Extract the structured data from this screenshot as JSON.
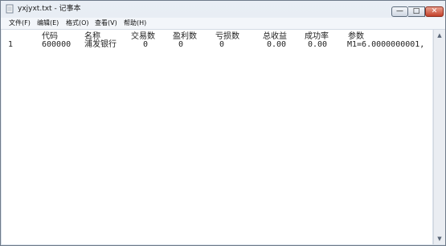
{
  "window": {
    "title": "yxjyxt.txt - 记事本"
  },
  "controls": {
    "minimize": "—",
    "maximize": "□",
    "close": "✕"
  },
  "menu": [
    "文件(F)",
    "编辑(E)",
    "格式(O)",
    "查看(V)",
    "帮助(H)"
  ],
  "editor": {
    "headers": [
      "代码",
      "名称",
      "交易数",
      "盈利数",
      "亏损数",
      "总收益",
      "成功率",
      "参数"
    ],
    "row": [
      "1",
      "600000",
      "浦发银行",
      "0",
      "0",
      "0",
      "0.00",
      "0.00",
      "M1=6.0000000001,"
    ]
  },
  "icons": {
    "app": "notepad-icon",
    "up": "scroll-up-icon",
    "down": "scroll-down-icon"
  },
  "colors": {
    "close": "#c3412b",
    "frame": "#dbe3ed"
  }
}
